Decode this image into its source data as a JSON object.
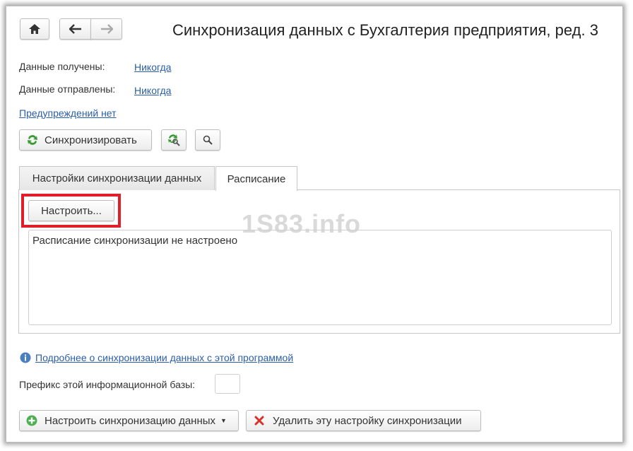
{
  "window": {
    "title": "Синхронизация данных с Бухгалтерия предприятия, ред. 3"
  },
  "nav": {
    "home_icon": "home-icon",
    "back_icon": "arrow-left-icon",
    "forward_icon": "arrow-right-icon"
  },
  "status": {
    "received_label": "Данные получены:",
    "received_value": "Никогда",
    "sent_label": "Данные отправлены:",
    "sent_value": "Никогда",
    "warnings_link": "Предупреждений нет"
  },
  "toolbar": {
    "sync_label": "Синхронизировать",
    "sync_icon": "sync-icon",
    "refresh_search_icon": "refresh-search-icon",
    "search_icon": "search-icon"
  },
  "tabs": [
    {
      "label": "Настройки синхронизации данных",
      "active": false
    },
    {
      "label": "Расписание",
      "active": true
    }
  ],
  "schedule": {
    "configure_label": "Настроить...",
    "text": "Расписание синхронизации не настроено"
  },
  "watermark": "1S83.info",
  "info": {
    "info_icon": "info-icon",
    "more_link": "Подробнее о синхронизации данных с этой программой"
  },
  "prefix": {
    "label": "Префикс этой информационной базы:",
    "value": ""
  },
  "bottom": {
    "setup_label": "Настроить синхронизацию данных",
    "setup_icon": "plus-circle-icon",
    "delete_label": "Удалить эту настройку синхронизации",
    "delete_icon": "delete-x-icon"
  },
  "colors": {
    "link": "#2a5ea8",
    "highlight": "#e11d2a",
    "sync_green": "#3a9b35",
    "delete_red": "#d9302b"
  }
}
